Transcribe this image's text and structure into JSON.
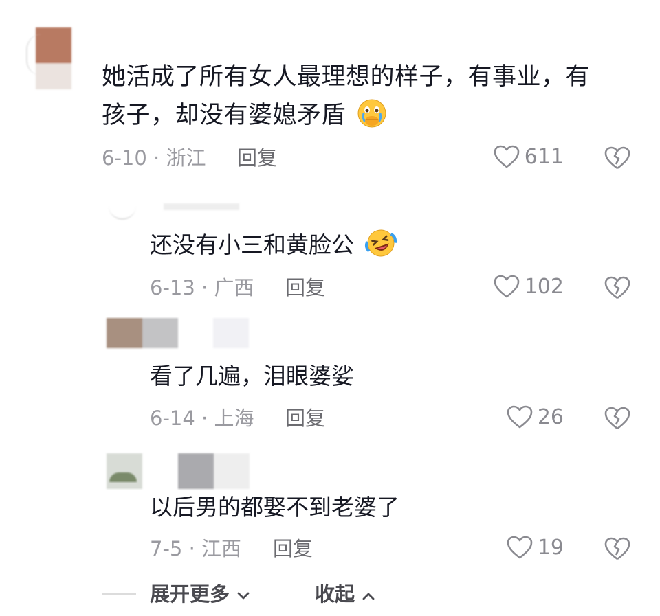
{
  "colors": {
    "text_primary": "#161823",
    "text_meta": "#9a9aa0",
    "reply_color": "#6b6b70",
    "icon_color": "#8a8a90"
  },
  "comment": {
    "text": "她活成了所有女人最理想的样子，有事业，有孩子，却没有婆媳矛盾",
    "text_line1": "她活成了所有女人最理想的样子，有事业，有",
    "text_line2": "孩子，却没有婆媳矛盾",
    "emoji": "crying-face-hands-over-mouth",
    "date": "6-10",
    "location": "浙江",
    "reply_label": "回复",
    "likes": "611"
  },
  "replies": [
    {
      "text": "还没有小三和黄脸公",
      "emoji": "laughing-crying-face",
      "date": "6-13",
      "location": "广西",
      "reply_label": "回复",
      "likes": "102"
    },
    {
      "text": "看了几遍，泪眼婆娑",
      "date": "6-14",
      "location": "上海",
      "reply_label": "回复",
      "likes": "26"
    },
    {
      "text": "以后男的都娶不到老婆了",
      "date": "7-5",
      "location": "江西",
      "reply_label": "回复",
      "likes": "19"
    }
  ],
  "footer": {
    "expand_label": "展开更多",
    "collapse_label": "收起"
  },
  "icons": [
    "heart-icon",
    "broken-heart-icon",
    "chevron-down-icon",
    "chevron-up-icon"
  ]
}
